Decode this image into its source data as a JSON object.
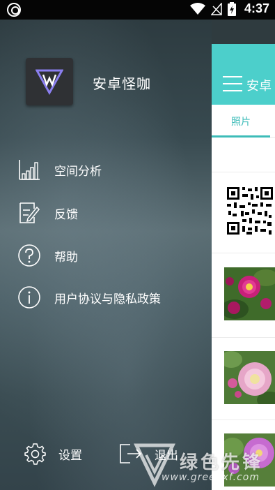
{
  "status_bar": {
    "time": "4:37",
    "icons": [
      "app-notification-icon",
      "wifi-icon",
      "no-signal-icon",
      "battery-charging-icon"
    ]
  },
  "drawer": {
    "app_name": "安卓怪咖",
    "menu": [
      {
        "label": "空间分析",
        "icon": "bar-chart-icon"
      },
      {
        "label": "反馈",
        "icon": "edit-note-icon"
      },
      {
        "label": "帮助",
        "icon": "help-circle-icon"
      },
      {
        "label": "用户协议与隐私政策",
        "icon": "info-circle-icon"
      }
    ],
    "settings_label": "设置",
    "logout_label": "退出"
  },
  "main": {
    "title": "安卓",
    "tab_label": "照片",
    "thumbnails": [
      "qr-code",
      "peony-flower",
      "pink-peony-flower",
      "purple-peony-flower"
    ]
  },
  "watermark": {
    "title": "绿色先锋",
    "url": "www.greenxf.com"
  },
  "colors": {
    "accent": "#4ccfcb",
    "tab_accent": "#3dbcb8",
    "logo_purple": "#8b7ff0"
  }
}
